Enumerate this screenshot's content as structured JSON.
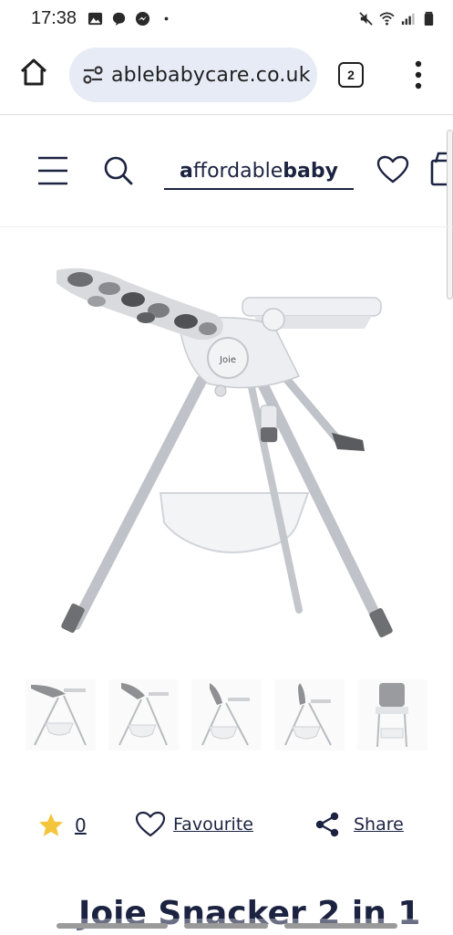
{
  "status_bar": {
    "time": "17:38",
    "left_icons": [
      "image-icon",
      "chat-bubble-icon",
      "messenger-icon",
      "dot-icon"
    ],
    "right_icons": [
      "mute-icon",
      "wifi-icon",
      "signal-icon",
      "battery-icon"
    ]
  },
  "browser": {
    "url": "ablebabycare.co.uk",
    "tab_count": "2",
    "accent_bg": "#e6ebf6"
  },
  "site_header": {
    "logo_first_letter": "a",
    "logo_regular": "ffordable",
    "logo_bold": "baby",
    "brand_color": "#1c2341"
  },
  "product": {
    "image_alt": "Joie Snacker 2 in 1 highchair",
    "brand_mark": "Joie",
    "thumbnail_count": 5,
    "rating_count": "0",
    "favourite_label": "Favourite",
    "share_label": "Share",
    "title": "Joie Snacker 2 in 1",
    "star_color": "#f2c53d"
  }
}
